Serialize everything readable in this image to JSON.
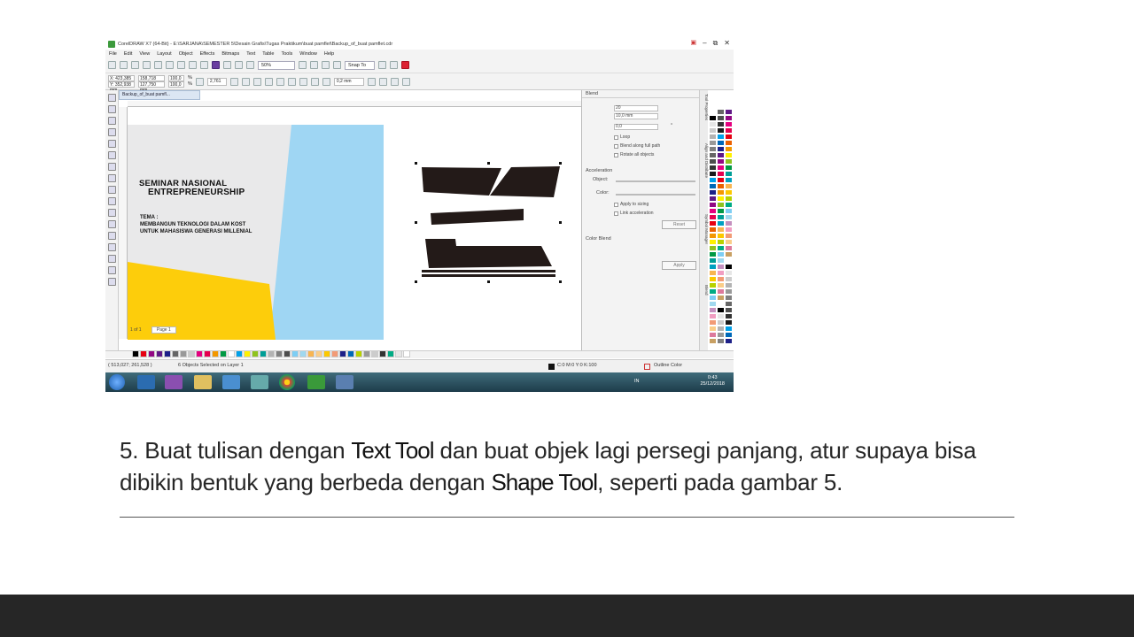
{
  "screenshot": {
    "window_title": "CorelDRAW X7 (64-Bit) - E:\\SARJANA\\SEMESTER 5\\Desain Grafis\\Tugas Praktikum\\buat pamflet\\Backup_of_buat pamflet.cdr",
    "menu": [
      "File",
      "Edit",
      "View",
      "Layout",
      "Object",
      "Effects",
      "Bitmaps",
      "Text",
      "Table",
      "Tools",
      "Window",
      "Help"
    ],
    "zoom": "50%",
    "snap": "Snap To",
    "props": {
      "x": "X: 423,385 mm",
      "y": "Y: 352,938 mm",
      "w": "158,718 mm",
      "h": "127,750 mm",
      "sx": "100,0",
      "sy": "100,0",
      "pct": "%",
      "angle": "2,761",
      "outline": "0,2 mm"
    },
    "doc_tab": "Backup_of_buat pamfl...",
    "page_text": {
      "title_line1": "SEMINAR NASIONAL",
      "title_line2": "ENTREPRENEURSHIP",
      "tema_label": "TEMA :",
      "tema_line1": "MEMBANGUN TEKNOLOGI DALAM KOST",
      "tema_line2": "UNTUK MAHASISWA GENERASI MILLENIAL"
    },
    "docker": {
      "title": "Blend",
      "steps": "20",
      "spacing": "10,0 mm",
      "rotation": "0,0",
      "degree": "°",
      "loop": "Loop",
      "blend_path": "Blend along full path",
      "rotate_all": "Rotate all objects",
      "acceleration": "Acceleration",
      "object": "Object:",
      "color": "Color:",
      "apply_sizing": "Apply to sizing",
      "link_accel": "Link acceleration",
      "reset": "Reset",
      "color_blend": "Color Blend",
      "apply": "Apply"
    },
    "side_tabs": [
      "Tool Properties",
      "Align and Distribute",
      "Symbol Manager",
      "Blend"
    ],
    "page_nav": "1 of 1",
    "page_tab": "Page 1",
    "status_coords": "( 513,027; 261,528 )",
    "status_sel": "6 Objects Selected on Layer 1",
    "status_fill": "C:0 M:0 Y:0 K:100",
    "status_outline": "Outline Color",
    "tray_lang": "IN",
    "clock_time": "0:43",
    "clock_date": "25/12/2018",
    "colors": {
      "yellow": "#fdcd0b",
      "sky": "#9fd6f3",
      "shape": "#231a18",
      "page_grey": "#e9e9ea"
    }
  },
  "instruction": {
    "prefix": "5. Buat tulisan dengan ",
    "tool1": "Text Tool",
    "middle": " dan buat objek lagi persegi panjang, atur supaya bisa dibikin bentuk yang berbeda dengan ",
    "tool2": "Shape Tool",
    "suffix": ", seperti pada gambar 5."
  }
}
